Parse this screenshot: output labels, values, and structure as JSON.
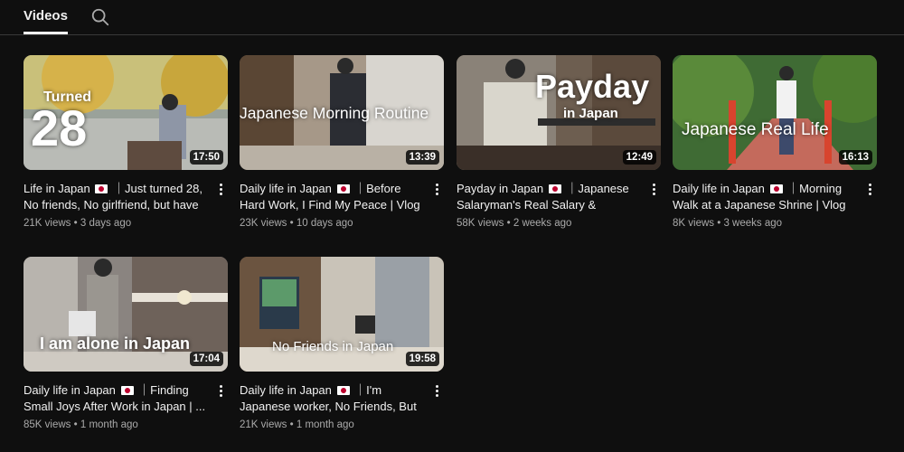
{
  "tabs": {
    "videos": "Videos",
    "search_icon": "search-icon"
  },
  "videos": [
    {
      "title_pre": "Life in Japan",
      "title_post": "｜Just turned 28, No friends, No girlfriend, but have ...",
      "views": "21K views",
      "age": "3 days ago",
      "duration": "17:50",
      "overlay_line1": "Turned",
      "overlay_line2": "28"
    },
    {
      "title_pre": "Daily life in Japan",
      "title_post": "｜Before Hard Work, I Find My Peace | Vlog",
      "views": "23K views",
      "age": "10 days ago",
      "duration": "13:39",
      "overlay": "Japanese Morning Routine"
    },
    {
      "title_pre": "Payday in Japan",
      "title_post": "｜Japanese Salaryman's Real Salary & Payday...",
      "views": "58K views",
      "age": "2 weeks ago",
      "duration": "12:49",
      "overlay_line1": "Payday",
      "overlay_line2": "in Japan"
    },
    {
      "title_pre": "Daily life in Japan",
      "title_post": "｜Morning Walk at a Japanese Shrine | Vlog",
      "views": "8K views",
      "age": "3 weeks ago",
      "duration": "16:13",
      "overlay": "Japanese Real Life"
    },
    {
      "title_pre": "Daily life in Japan",
      "title_post": "｜Finding Small Joys After Work in Japan | ...",
      "views": "85K views",
      "age": "1 month ago",
      "duration": "17:04",
      "overlay": "I am alone in Japan"
    },
    {
      "title_pre": "Daily life in Japan",
      "title_post": "｜I'm Japanese worker, No Friends, But I...",
      "views": "21K views",
      "age": "1 month ago",
      "duration": "19:58",
      "overlay": "No Friends in Japan"
    }
  ],
  "separator": "•",
  "colors": {
    "background": "#0f0f0f",
    "text": "#f1f1f1",
    "meta": "#aaaaaa",
    "flag_red": "#bc002d"
  }
}
